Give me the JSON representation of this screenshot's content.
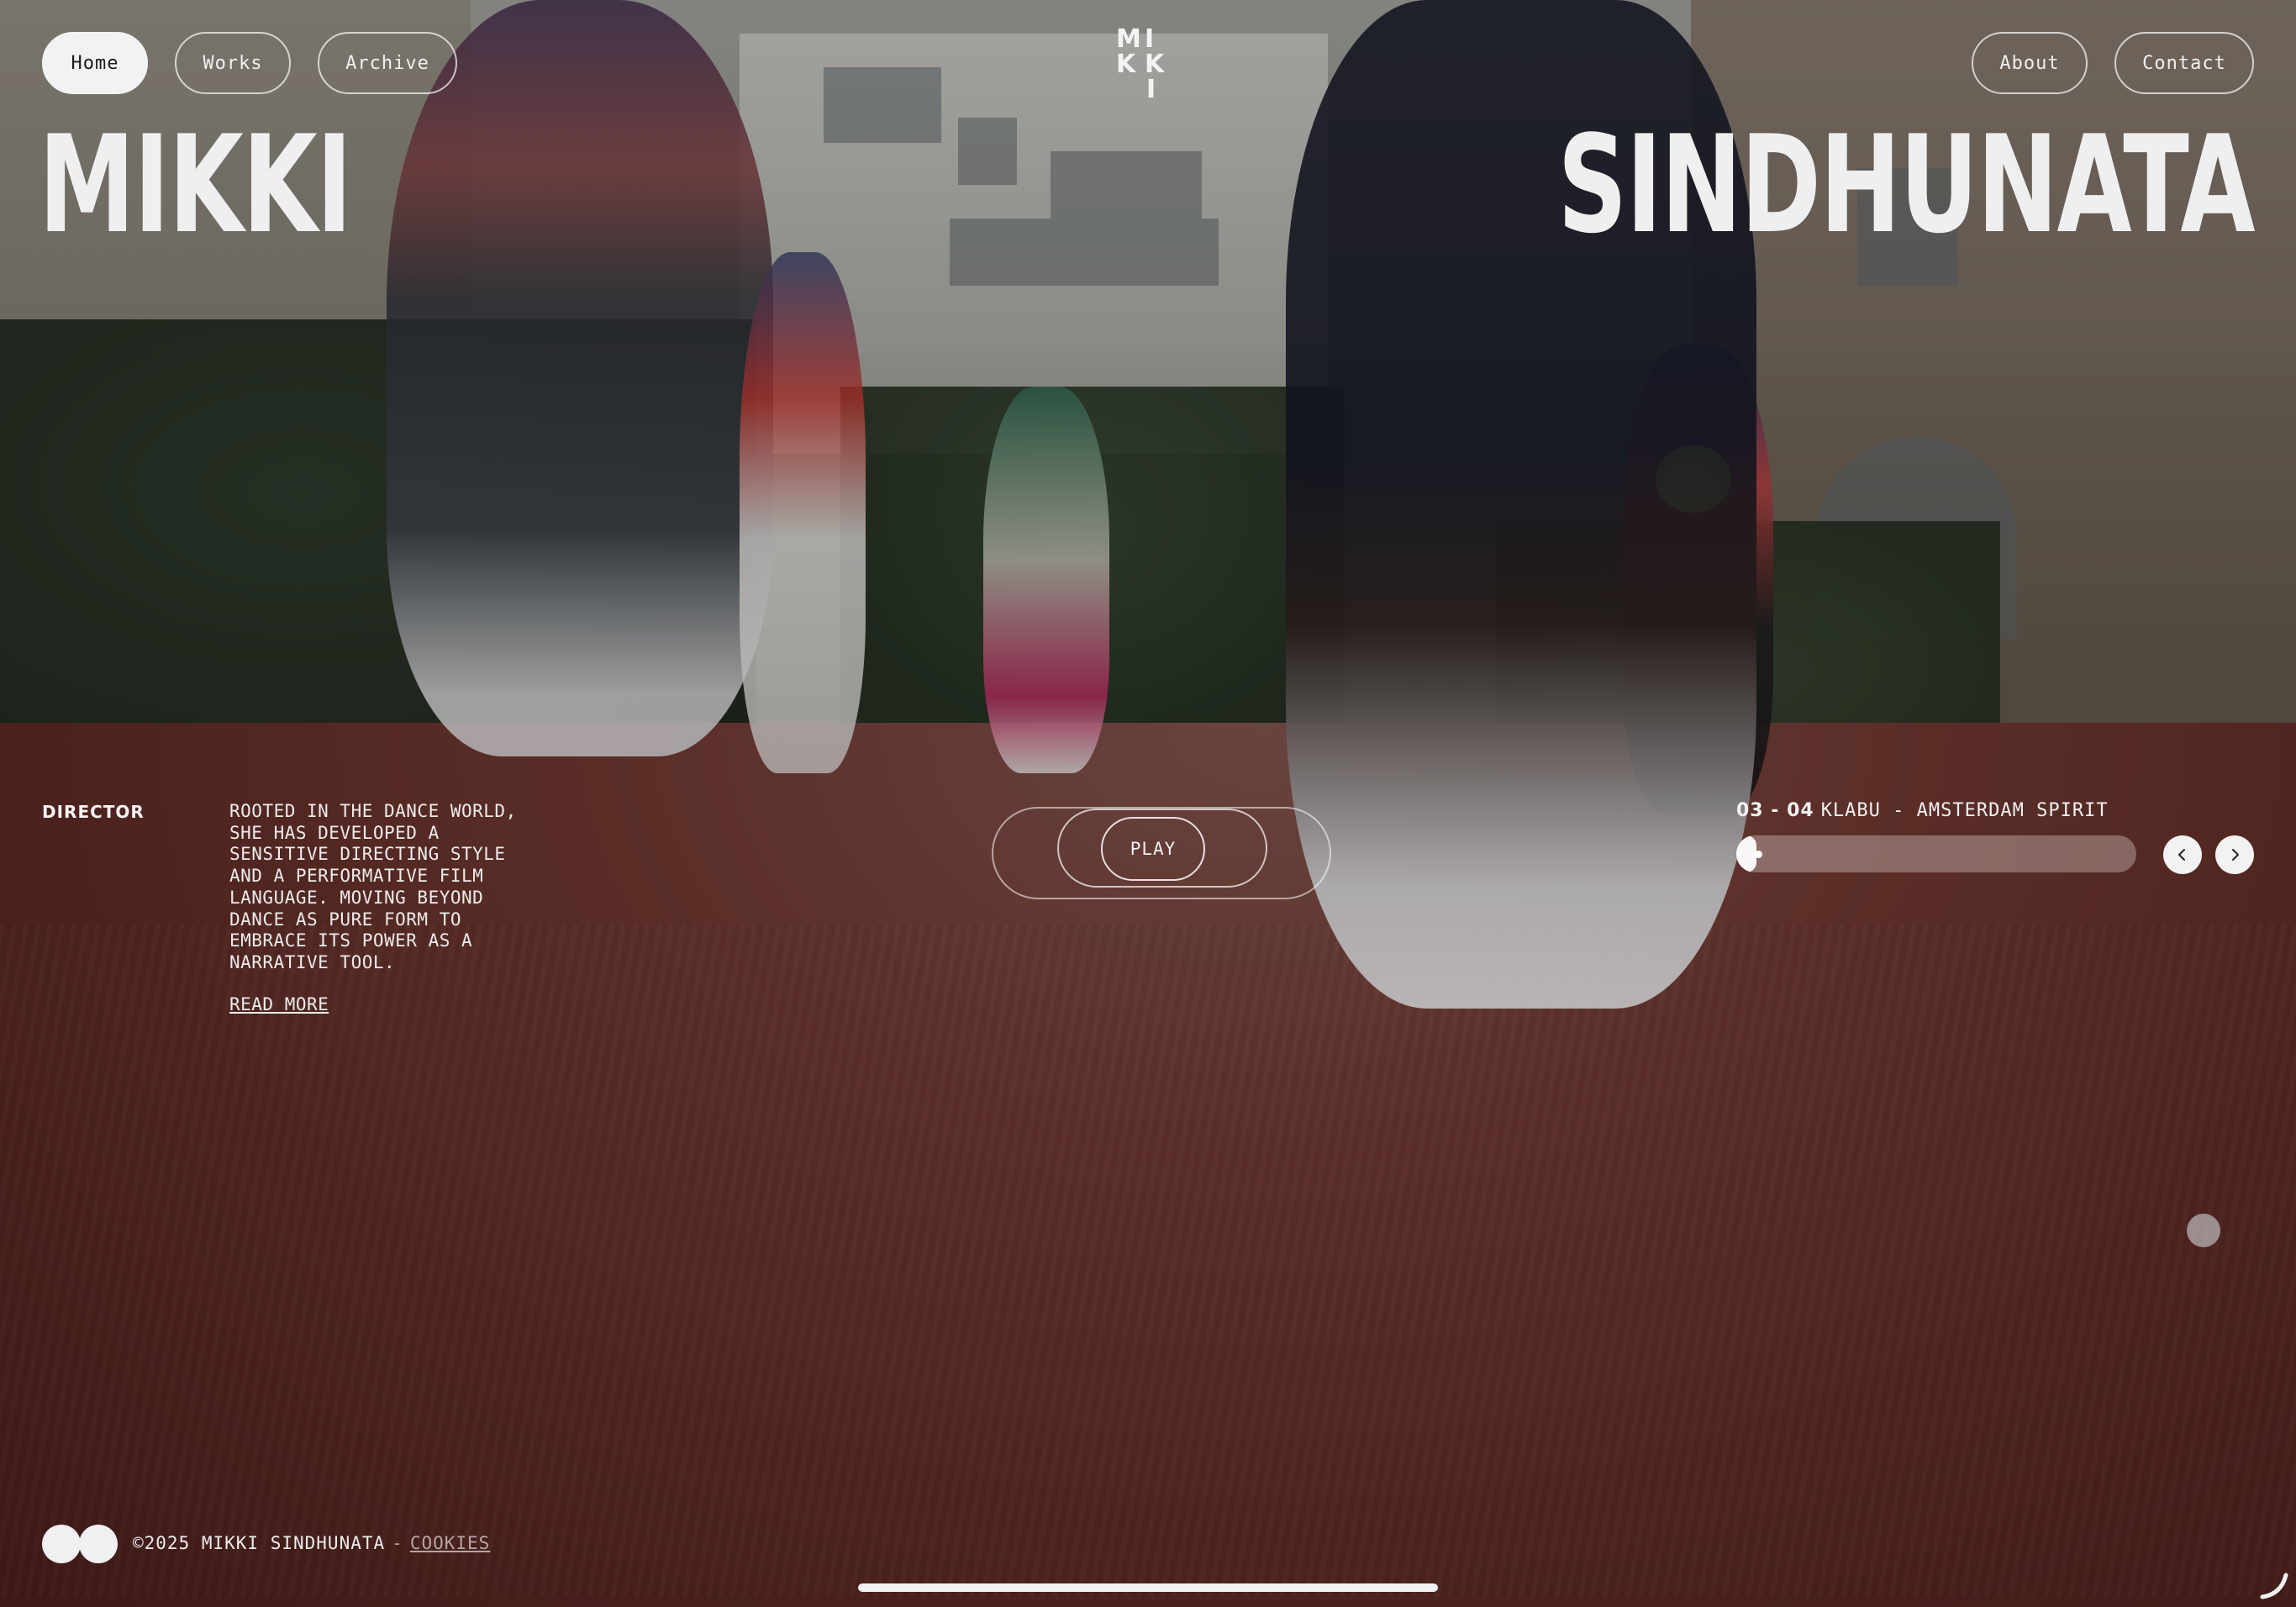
{
  "nav": {
    "left": [
      {
        "label": "Home",
        "active": true
      },
      {
        "label": "Works",
        "active": false
      },
      {
        "label": "Archive",
        "active": false
      }
    ],
    "right": [
      {
        "label": "About"
      },
      {
        "label": "Contact"
      }
    ]
  },
  "logo": {
    "letters": [
      "M",
      "I",
      "K",
      "K",
      "I"
    ]
  },
  "hero": {
    "first_name": "MIKKI",
    "last_name": "SINDHUNATA"
  },
  "intro": {
    "role": "DIRECTOR",
    "bio": "ROOTED IN THE DANCE WORLD, SHE HAS DEVELOPED A SENSITIVE DIRECTING STYLE AND A PERFORMATIVE FILM LANGUAGE. MOVING BEYOND DANCE AS PURE FORM TO EMBRACE ITS POWER AS A NARRATIVE TOOL.",
    "read_more": "READ MORE"
  },
  "player": {
    "play_label": "PLAY"
  },
  "slider": {
    "counter": "03 - 04",
    "title": "KLABU - AMSTERDAM SPIRIT",
    "progress": 0.05,
    "prev_icon": "chevron-left-icon",
    "next_icon": "chevron-right-icon"
  },
  "footer": {
    "copyright": "©2025 MIKKI SINDHUNATA",
    "separator": "-",
    "cookies": "COOKIES"
  },
  "colors": {
    "text": "#f2f2f2",
    "pill_active_bg": "#f2f2f2",
    "pill_active_text": "#1b1b1b"
  }
}
